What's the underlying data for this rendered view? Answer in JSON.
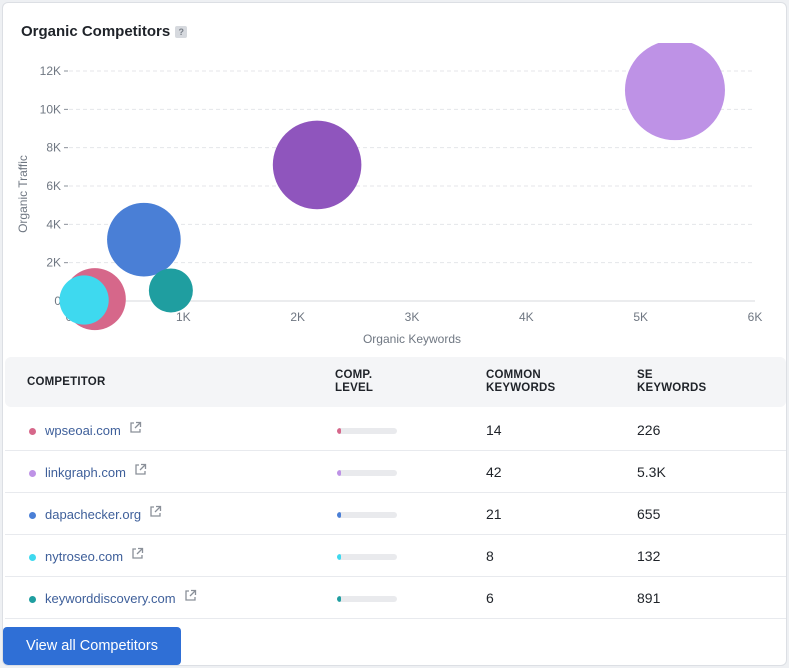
{
  "card": {
    "title": "Organic Competitors",
    "help": "?"
  },
  "chart_data": {
    "type": "scatter",
    "xlabel": "Organic Keywords",
    "ylabel": "Organic Traffic",
    "xlim": [
      0,
      6000
    ],
    "ylim": [
      0,
      12000
    ],
    "x_ticks": [
      0,
      1000,
      2000,
      3000,
      4000,
      5000,
      6000
    ],
    "x_tick_labels": [
      "0",
      "1K",
      "2K",
      "3K",
      "4K",
      "5K",
      "6K"
    ],
    "y_ticks": [
      0,
      2000,
      4000,
      6000,
      8000,
      10000,
      12000
    ],
    "y_tick_labels": [
      "0",
      "2K",
      "4K",
      "6K",
      "8K",
      "10K",
      "12K"
    ],
    "grid": true,
    "points": [
      {
        "name": "wpseoai.com",
        "x": 226,
        "y": 100,
        "size": 14,
        "color": "#d6678a"
      },
      {
        "name": "linkgraph.com",
        "x": 5300,
        "y": 11000,
        "size": 42,
        "color": "#be92e6"
      },
      {
        "name": "dapachecker.org",
        "x": 655,
        "y": 3200,
        "size": 21,
        "color": "#4a7fd6"
      },
      {
        "name": "nytroseo.com",
        "x": 132,
        "y": 50,
        "size": 8,
        "color": "#3ed9ef"
      },
      {
        "name": "keyworddiscovery.com",
        "x": 891,
        "y": 550,
        "size": 6,
        "color": "#1f9ea0"
      },
      {
        "name": "",
        "x": 2170,
        "y": 7100,
        "size": 32,
        "color": "#8f55bd"
      }
    ]
  },
  "table": {
    "headers": {
      "competitor": "COMPETITOR",
      "comp_level": "COMP.\nLEVEL",
      "common_keywords": "COMMON\nKEYWORDS",
      "se_keywords": "SE\nKEYWORDS"
    },
    "rows": [
      {
        "domain": "wpseoai.com",
        "color": "#d6678a",
        "comp_level": 0.07,
        "common_keywords": "14",
        "se_keywords": "226"
      },
      {
        "domain": "linkgraph.com",
        "color": "#be92e6",
        "comp_level": 0.07,
        "common_keywords": "42",
        "se_keywords": "5.3K"
      },
      {
        "domain": "dapachecker.org",
        "color": "#4a7fd6",
        "comp_level": 0.07,
        "common_keywords": "21",
        "se_keywords": "655"
      },
      {
        "domain": "nytroseo.com",
        "color": "#3ed9ef",
        "comp_level": 0.06,
        "common_keywords": "8",
        "se_keywords": "132"
      },
      {
        "domain": "keyworddiscovery.com",
        "color": "#1f9ea0",
        "comp_level": 0.05,
        "common_keywords": "6",
        "se_keywords": "891"
      }
    ]
  },
  "footer": {
    "view_all_label": "View all Competitors"
  }
}
